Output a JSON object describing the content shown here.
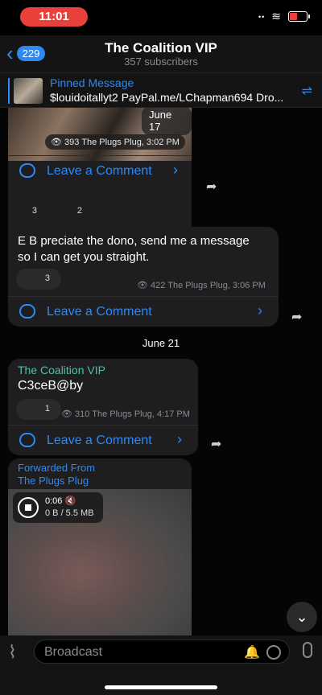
{
  "status": {
    "time": "11:01",
    "signal_glyph": "••",
    "wifi_glyph": "≋"
  },
  "header": {
    "back_count": "229",
    "title": "The Coalition VIP",
    "subtitle": "357 subscribers"
  },
  "pinned": {
    "title": "Pinned Message",
    "text": "$louidoitallyt2 PayPal.me/LChapman694 Dro..."
  },
  "messages": [
    {
      "date_chip": "June 17",
      "views": "393 The Plugs Plug, 3:02 PM",
      "comment_label": "Leave a Comment",
      "reactions": [
        "3",
        "2"
      ]
    },
    {
      "text_line1": "E B preciate the dono, send me a message",
      "text_line2": "so I can get you straight.",
      "reaction": "3",
      "meta": "422 The Plugs Plug, 3:06 PM",
      "comment_label": "Leave a Comment"
    },
    {
      "channel": "The Coalition VIP",
      "text": "C3ceB@by",
      "reaction": "1",
      "meta": "310 The Plugs Plug, 4:17 PM",
      "comment_label": "Leave a Comment"
    },
    {
      "fwd_line1": "Forwarded From",
      "fwd_line2": "The Plugs Plug",
      "video_time": "0:06 🔇",
      "video_size": "0 B / 5.5 MB"
    }
  ],
  "day_separator": "June 21",
  "input": {
    "placeholder": "Broadcast"
  },
  "icons": {
    "back": "‹",
    "pin": "⇌",
    "share": "➦",
    "chevron": "›",
    "down": "⌄",
    "clip": "⌇",
    "bell": "🔔"
  }
}
